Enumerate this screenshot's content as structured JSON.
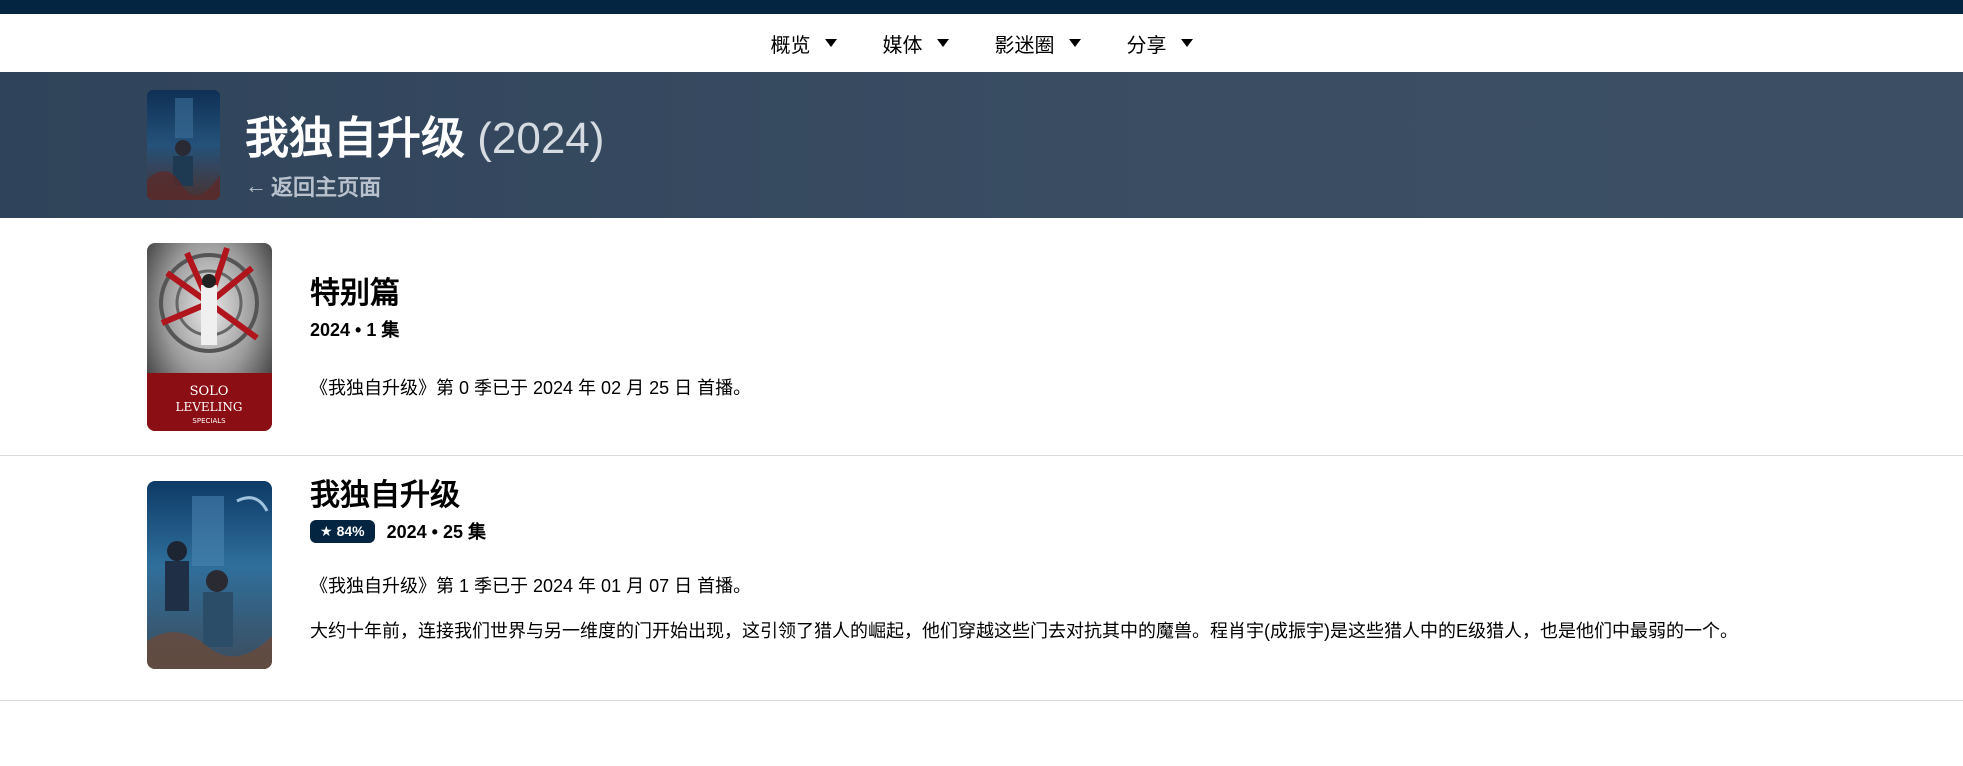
{
  "nav": {
    "items": [
      {
        "label": "概览"
      },
      {
        "label": "媒体"
      },
      {
        "label": "影迷圈"
      },
      {
        "label": "分享"
      }
    ]
  },
  "header": {
    "title": "我独自升级",
    "year": "(2024)",
    "back_label": "返回主页面"
  },
  "seasons": [
    {
      "title": "特别篇",
      "meta": "2024 • 1 集",
      "air_text": "《我独自升级》第 0 季已于 2024 年 02 月 25 日 首播。",
      "poster_text_1": "SOLO",
      "poster_text_2": "LEVELING",
      "poster_text_3": "SPECIALS"
    },
    {
      "title": "我独自升级",
      "rating": "84%",
      "meta": "2024 • 25 集",
      "air_text": "《我独自升级》第 1 季已于 2024 年 01 月 07 日 首播。",
      "overview": "大约十年前，连接我们世界与另一维度的门开始出现，这引领了猎人的崛起，他们穿越这些门去对抗其中的魔兽。程肖宇(成振宇)是这些猎人中的E级猎人，也是他们中最弱的一个。"
    }
  ]
}
